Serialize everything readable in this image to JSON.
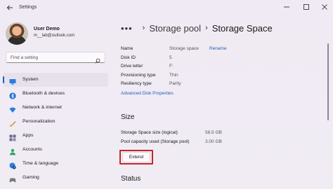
{
  "window": {
    "title": "Settings",
    "back_icon": "back-arrow-icon",
    "controls": [
      "minimize-icon",
      "maximize-icon",
      "close-icon"
    ]
  },
  "profile": {
    "name": "User Demo",
    "email": "m__lab@outlook.com"
  },
  "search": {
    "placeholder": "Find a setting",
    "icon": "search-icon"
  },
  "sidebar": {
    "items": [
      {
        "label": "System",
        "icon": "monitor-icon",
        "active": true
      },
      {
        "label": "Bluetooth & devices",
        "icon": "bluetooth-icon"
      },
      {
        "label": "Network & internet",
        "icon": "wifi-icon"
      },
      {
        "label": "Personalization",
        "icon": "brush-icon"
      },
      {
        "label": "Apps",
        "icon": "apps-icon"
      },
      {
        "label": "Accounts",
        "icon": "person-icon"
      },
      {
        "label": "Time & language",
        "icon": "globe-clock-icon"
      },
      {
        "label": "Gaming",
        "icon": "gamepad-icon"
      }
    ]
  },
  "breadcrumb": {
    "more": "•••",
    "separator": "›",
    "parent": "Storage pool",
    "current": "Storage Space"
  },
  "properties": {
    "name_label": "Name",
    "name_value": "Storage space",
    "rename_link": "Rename",
    "disk_id_label": "Disk ID",
    "disk_id_value": "5",
    "drive_letter_label": "Drive letter",
    "drive_letter_value": "F:",
    "provisioning_label": "Provisioning type",
    "provisioning_value": "Thin",
    "resiliency_label": "Resiliency type",
    "resiliency_value": "Parity",
    "advanced_link": "Advanced Disk Properties"
  },
  "size_section": {
    "title": "Size",
    "logical_label": "Storage Space size (logical)",
    "logical_value": "58.5 GB",
    "pool_label": "Pool capacity used (Storage pool)",
    "pool_value": "3.00 GB",
    "extend_button": "Extend",
    "highlight_color": "#c0272d"
  },
  "status_section": {
    "title": "Status"
  },
  "colors": {
    "accent": "#1f5fbf",
    "background": "#f1ecf4"
  }
}
